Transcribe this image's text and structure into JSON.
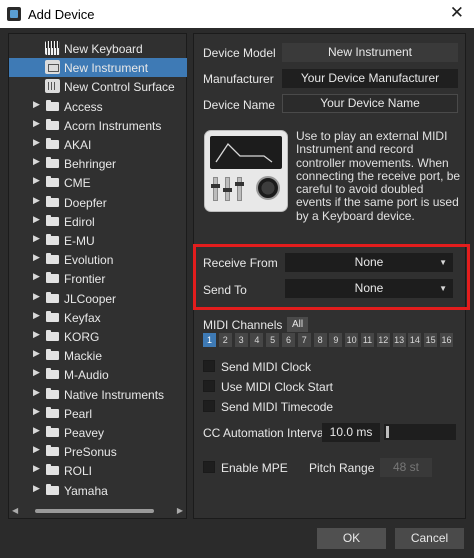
{
  "window": {
    "title": "Add Device",
    "close_glyph": "✕"
  },
  "tree": {
    "items": [
      {
        "label": "New Keyboard",
        "icon": "keyboard-icon",
        "kind": "device"
      },
      {
        "label": "New Instrument",
        "icon": "instrument-icon",
        "kind": "device",
        "selected": true
      },
      {
        "label": "New Control Surface",
        "icon": "control-surface-icon",
        "kind": "device"
      },
      {
        "label": "Access",
        "kind": "folder"
      },
      {
        "label": "Acorn Instruments",
        "kind": "folder"
      },
      {
        "label": "AKAI",
        "kind": "folder"
      },
      {
        "label": "Behringer",
        "kind": "folder"
      },
      {
        "label": "CME",
        "kind": "folder"
      },
      {
        "label": "Doepfer",
        "kind": "folder"
      },
      {
        "label": "Edirol",
        "kind": "folder"
      },
      {
        "label": "E-MU",
        "kind": "folder"
      },
      {
        "label": "Evolution",
        "kind": "folder"
      },
      {
        "label": "Frontier",
        "kind": "folder"
      },
      {
        "label": "JLCooper",
        "kind": "folder"
      },
      {
        "label": "Keyfax",
        "kind": "folder"
      },
      {
        "label": "KORG",
        "kind": "folder"
      },
      {
        "label": "Mackie",
        "kind": "folder"
      },
      {
        "label": "M-Audio",
        "kind": "folder"
      },
      {
        "label": "Native Instruments",
        "kind": "folder"
      },
      {
        "label": "Pearl",
        "kind": "folder"
      },
      {
        "label": "Peavey",
        "kind": "folder"
      },
      {
        "label": "PreSonus",
        "kind": "folder"
      },
      {
        "label": "ROLI",
        "kind": "folder"
      },
      {
        "label": "Yamaha",
        "kind": "folder"
      }
    ]
  },
  "device": {
    "model_label": "Device Model",
    "model_value": "New Instrument",
    "manufacturer_label": "Manufacturer",
    "manufacturer_value": "Your Device Manufacturer",
    "name_label": "Device Name",
    "name_value": "Your Device Name",
    "description": "Use to play an external MIDI Instrument and record controller movements. When connecting the receive port, be careful to avoid doubled events if the same port is used by a Keyboard device."
  },
  "ports": {
    "receive_label": "Receive From",
    "receive_value": "None",
    "send_label": "Send To",
    "send_value": "None",
    "highlight_color": "#e31d1d"
  },
  "midi": {
    "channels_label": "MIDI Channels",
    "all_label": "All",
    "channels": [
      "1",
      "2",
      "3",
      "4",
      "5",
      "6",
      "7",
      "8",
      "9",
      "10",
      "11",
      "12",
      "13",
      "14",
      "15",
      "16"
    ],
    "active_channel": "1",
    "send_clock_label": "Send MIDI Clock",
    "clock_start_label": "Use MIDI Clock Start",
    "timecode_label": "Send MIDI Timecode",
    "cc_interval_label": "CC Automation Interval",
    "cc_interval_value": "10.0 ms",
    "enable_mpe_label": "Enable MPE",
    "pitch_range_label": "Pitch Range",
    "pitch_range_value": "48 st"
  },
  "buttons": {
    "ok": "OK",
    "cancel": "Cancel"
  },
  "colors": {
    "accent": "#3e7ab5",
    "background": "#2b2b2b",
    "panel": "#303030"
  }
}
